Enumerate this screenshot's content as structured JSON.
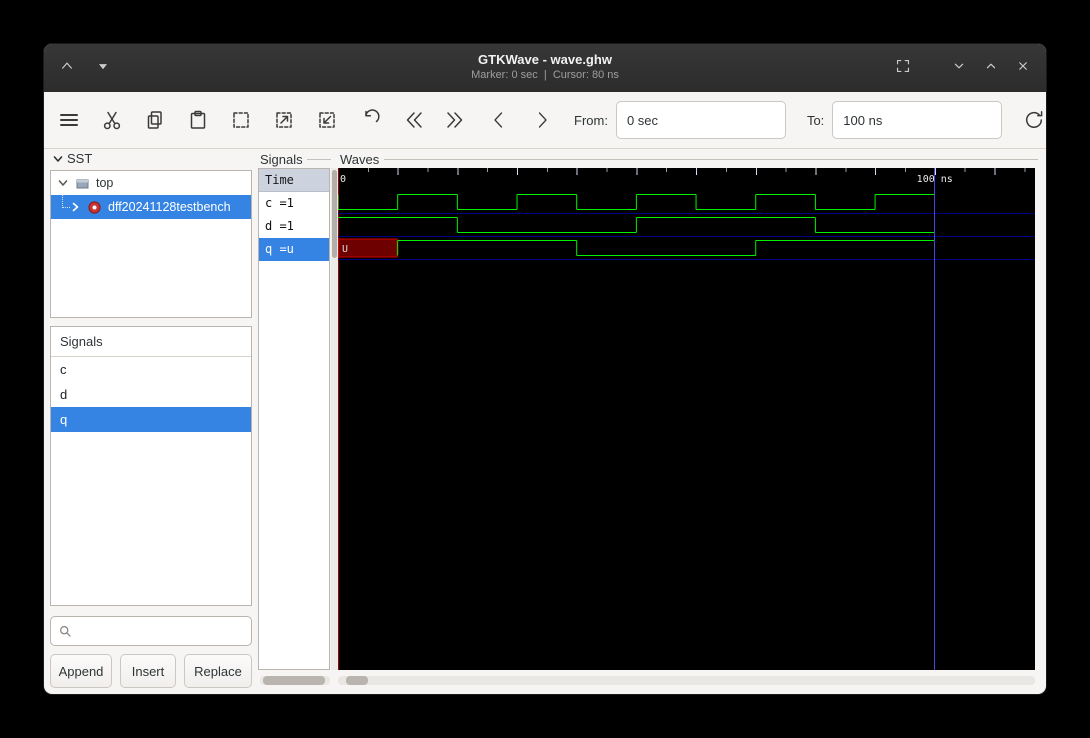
{
  "window": {
    "title": "GTKWave - wave.ghw",
    "statusline": "Marker: 0 sec  |  Cursor: 80 ns"
  },
  "toolbar": {
    "icons": [
      "menu-icon",
      "cut-icon",
      "copy-icon",
      "paste-icon",
      "zoom-fit-icon",
      "zoom-in-icon",
      "zoom-out-icon",
      "undo-icon",
      "go-first-icon",
      "go-last-icon",
      "go-previous-icon",
      "go-next-icon",
      "reload-icon"
    ],
    "from_label": "From:",
    "from_value": "0 sec",
    "to_label": "To:",
    "to_value": "100 ns"
  },
  "sst": {
    "label": "SST",
    "tree": [
      {
        "label": "top"
      },
      {
        "label": "dff20241128testbench",
        "selected": true
      }
    ]
  },
  "signal_list": {
    "header": "Signals",
    "items": [
      "c",
      "d",
      "q"
    ],
    "selected": "q",
    "search_placeholder": "",
    "buttons": [
      "Append",
      "Insert",
      "Replace"
    ]
  },
  "names_panel": {
    "label": "Signals",
    "time_header": "Time",
    "rows": [
      {
        "text": "c =1"
      },
      {
        "text": "d =1"
      },
      {
        "text": "q =u",
        "selected": true
      }
    ]
  },
  "waves_panel": {
    "label": "Waves",
    "tick_labels": [
      "0",
      "100 ns"
    ]
  },
  "chart_data": {
    "type": "digital-waveform",
    "time_unit": "ns",
    "x_range_ns": [
      0,
      116.8
    ],
    "wave_end_ns": 100,
    "primary_marker_ns": 0,
    "cursor_ns": 80,
    "cursor_line_ns": 100,
    "undefined_label": "U",
    "signals": [
      {
        "name": "c",
        "value_at_marker": "1",
        "segments": [
          [
            0,
            0,
            "1"
          ],
          [
            0,
            10,
            "0"
          ],
          [
            10,
            20,
            "1"
          ],
          [
            20,
            30,
            "0"
          ],
          [
            30,
            40,
            "1"
          ],
          [
            40,
            50,
            "0"
          ],
          [
            50,
            60,
            "1"
          ],
          [
            60,
            70,
            "0"
          ],
          [
            70,
            80,
            "1"
          ],
          [
            80,
            90,
            "0"
          ],
          [
            90,
            100,
            "1"
          ]
        ]
      },
      {
        "name": "d",
        "value_at_marker": "1",
        "segments": [
          [
            0,
            20,
            "1"
          ],
          [
            20,
            50,
            "0"
          ],
          [
            50,
            80,
            "1"
          ],
          [
            80,
            100,
            "0"
          ]
        ]
      },
      {
        "name": "q",
        "value_at_marker": "u",
        "segments": [
          [
            0,
            10,
            "U"
          ],
          [
            10,
            40,
            "1"
          ],
          [
            40,
            70,
            "0"
          ],
          [
            70,
            100,
            "1"
          ]
        ]
      }
    ],
    "colors": {
      "trace": "#00f000",
      "undefined_fill": "#6e0000",
      "undefined_border": "#d40000",
      "cursor": "#4646e0",
      "marker": "#9c0000",
      "lane_line": "#000085",
      "background": "#000000"
    }
  }
}
